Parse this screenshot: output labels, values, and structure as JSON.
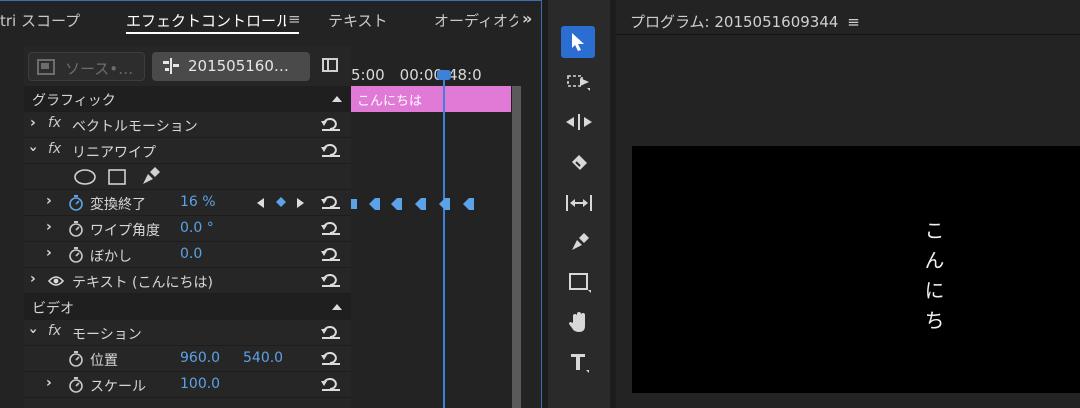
{
  "tabs": [
    {
      "label": "tri スコープ",
      "active": false
    },
    {
      "label": "エフェクトコントロール",
      "active": true
    },
    {
      "label": "テキスト",
      "active": false
    },
    {
      "label": "オーディオク",
      "active": false
    }
  ],
  "effect_controls": {
    "menu_icon": "≡",
    "more_tabs": "»",
    "source_button": "ソース•…",
    "clip_button": "201505160…",
    "timeline": {
      "ruler_text": "5:00　00:00:48:0",
      "clip_label": "こんにちは",
      "playhead_fraction": 0.57
    },
    "sections": {
      "graphic": "グラフィック",
      "video": "ビデオ"
    },
    "rows": {
      "vector_motion": "ベクトルモーション",
      "linear_wipe": "リニアワイプ",
      "transition_completion": {
        "label": "変換終了",
        "value": "16 %"
      },
      "wipe_angle": {
        "label": "ワイプ角度",
        "value": "0.0 °"
      },
      "feather": {
        "label": "ぼかし",
        "value": "0.0"
      },
      "text_layer": "テキスト (こんにちは)",
      "motion": "モーション",
      "position": {
        "label": "位置",
        "x": "960.0",
        "y": "540.0"
      },
      "scale": {
        "label": "スケール",
        "value": "100.0"
      }
    }
  },
  "tools": [
    "selection-tool",
    "track-select-tool",
    "ripple-edit-tool",
    "razor-tool",
    "slip-tool",
    "pen-tool",
    "rectangle-tool",
    "hand-tool",
    "type-tool"
  ],
  "program_monitor": {
    "title": "プログラム: 2015051609344",
    "menu_icon": "≡",
    "video_text": "こんにち"
  },
  "colors": {
    "accent_blue": "#3d82d8",
    "value_blue": "#5ca2e8",
    "clip_pink": "#e07ad6"
  }
}
